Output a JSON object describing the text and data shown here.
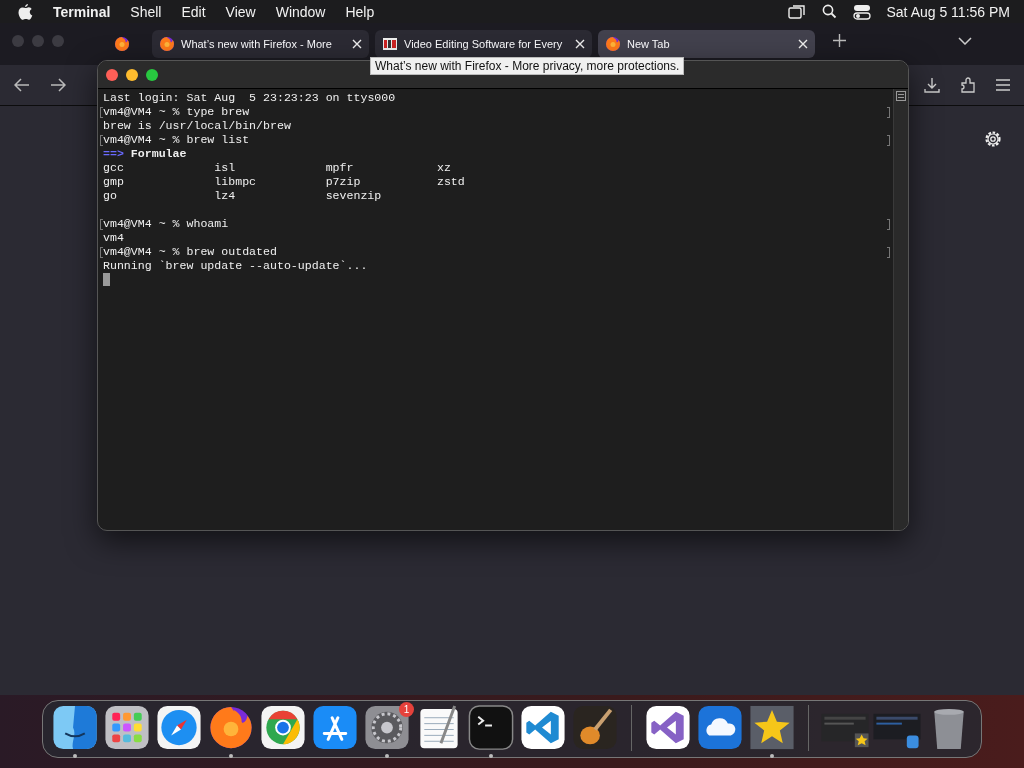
{
  "menu_bar": {
    "app": "Terminal",
    "menus": [
      "Shell",
      "Edit",
      "View",
      "Window",
      "Help"
    ],
    "clock": "Sat Aug 5  11:56 PM"
  },
  "browser": {
    "tabs": [
      {
        "kind": "firefox",
        "title": "What’s new with Firefox - More",
        "selected": false
      },
      {
        "kind": "nch",
        "title": "Video Editing Software for Every",
        "selected": false
      },
      {
        "kind": "firefox",
        "title": "New Tab",
        "selected": true
      }
    ],
    "tooltip": "What’s new with Firefox - More privacy, more protections."
  },
  "terminal": {
    "lines": [
      {
        "kind": "text",
        "text": "Last login: Sat Aug  5 23:23:23 on ttys000",
        "marked": false
      },
      {
        "kind": "text",
        "text": "vm4@VM4 ~ % type brew",
        "marked": true
      },
      {
        "kind": "text",
        "text": "brew is /usr/local/bin/brew",
        "marked": false
      },
      {
        "kind": "text",
        "text": "vm4@VM4 ~ % brew list",
        "marked": true
      },
      {
        "kind": "heading",
        "arrow": "==>",
        "text": "Formulae"
      },
      {
        "kind": "columns",
        "cells": [
          "gcc",
          "isl",
          "mpfr",
          "xz"
        ]
      },
      {
        "kind": "columns",
        "cells": [
          "gmp",
          "libmpc",
          "p7zip",
          "zstd"
        ]
      },
      {
        "kind": "columns",
        "cells": [
          "go",
          "lz4",
          "sevenzip"
        ]
      },
      {
        "kind": "blank"
      },
      {
        "kind": "text",
        "text": "vm4@VM4 ~ % whoami",
        "marked": true
      },
      {
        "kind": "text",
        "text": "vm4",
        "marked": false
      },
      {
        "kind": "text",
        "text": "vm4@VM4 ~ % brew outdated",
        "marked": true
      },
      {
        "kind": "text",
        "text": "Running `brew update --auto-update`...",
        "marked": false
      },
      {
        "kind": "cursor"
      }
    ]
  },
  "dock": {
    "apps": [
      {
        "kind": "finder",
        "running": true
      },
      {
        "kind": "launchpad",
        "running": false
      },
      {
        "kind": "safari",
        "running": false
      },
      {
        "kind": "firefox",
        "running": true
      },
      {
        "kind": "chrome",
        "running": false
      },
      {
        "kind": "appstore",
        "running": false
      },
      {
        "kind": "settings",
        "running": true,
        "badge": "1"
      },
      {
        "kind": "textedit",
        "running": false
      },
      {
        "kind": "terminal",
        "running": true
      },
      {
        "kind": "vscode",
        "running": false
      },
      {
        "kind": "garageband",
        "running": false
      },
      {
        "kind": "divider"
      },
      {
        "kind": "visualstudio",
        "running": false
      },
      {
        "kind": "weather",
        "running": false
      },
      {
        "kind": "star",
        "running": true
      },
      {
        "kind": "divider"
      },
      {
        "kind": "thumbnail-star",
        "running": false
      },
      {
        "kind": "thumbnail-finder",
        "running": false
      },
      {
        "kind": "trash",
        "running": false
      }
    ]
  }
}
